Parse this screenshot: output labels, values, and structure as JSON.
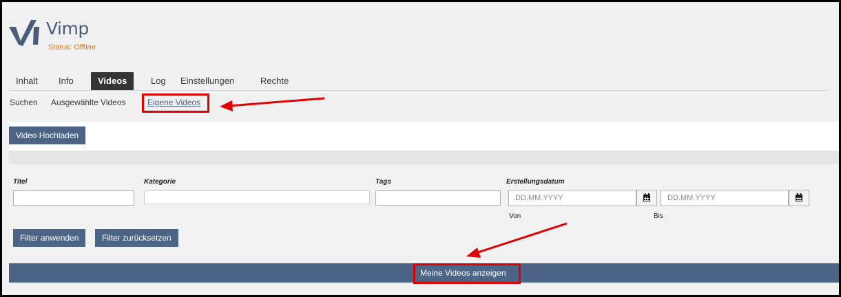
{
  "app": {
    "title": "Vimp",
    "status": "Status: Offline"
  },
  "tabs": [
    {
      "label": "Inhalt",
      "active": false
    },
    {
      "label": "Info",
      "active": false
    },
    {
      "label": "Videos",
      "active": true
    },
    {
      "label": "Log",
      "active": false
    },
    {
      "label": "Einstellungen",
      "active": false
    },
    {
      "label": "Rechte",
      "active": false
    }
  ],
  "subtabs": [
    {
      "label": "Suchen",
      "current": false
    },
    {
      "label": "Ausgewählte Videos",
      "current": false
    },
    {
      "label": "Eigene Videos",
      "current": true
    }
  ],
  "toolbar": {
    "upload_label": "Video Hochladen"
  },
  "filters": {
    "title_label": "Titel",
    "title_value": "",
    "category_label": "Kategorie",
    "category_value": "",
    "tags_label": "Tags",
    "tags_value": "",
    "date_label": "Erstellungsdatum",
    "date_from_placeholder": "DD.MM.YYYY",
    "date_to_placeholder": "DD.MM.YYYY",
    "from_label": "Von",
    "to_label": "Bis",
    "apply_label": "Filter anwenden",
    "reset_label": "Filter zurücksetzen"
  },
  "bottom": {
    "show_my_videos_label": "Meine Videos anzeigen"
  },
  "icons": {
    "calendar": "calendar-icon",
    "logo": "vimp-logo"
  },
  "colors": {
    "accent": "#4c6586",
    "active_tab": "#353535",
    "status": "#d77a1e",
    "highlight": "#e00000"
  }
}
